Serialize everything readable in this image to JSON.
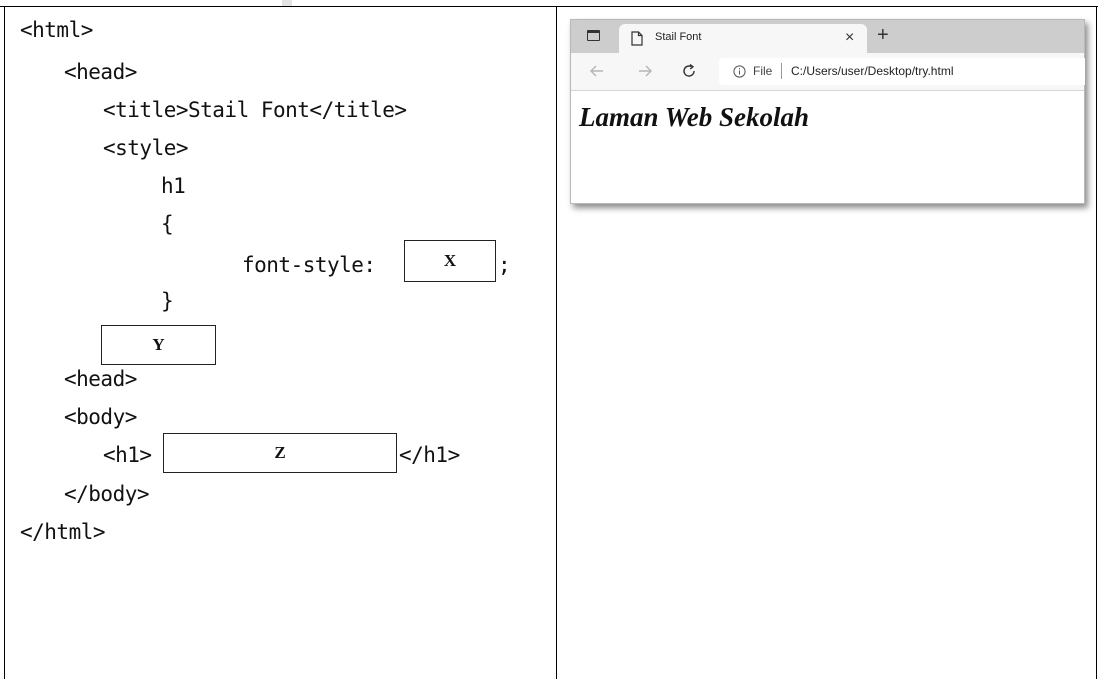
{
  "code": {
    "lines": [
      "<html>",
      "<head>",
      "<title>Stail Font</title>",
      "<style>",
      "h1",
      "{",
      "font-style:",
      "}",
      "<head>",
      "<body>",
      "<h1>",
      "</h1>",
      "</body>",
      "</html>"
    ],
    "semicolon": ";",
    "blanks": {
      "x": "X",
      "y": "Y",
      "z": "Z"
    }
  },
  "browser": {
    "tab_title": "Stail Font",
    "tab_close": "×",
    "new_tab": "+",
    "address": {
      "scheme_label": "File",
      "url": "C:/Users/user/Desktop/try.html"
    },
    "page_heading": "Laman Web Sekolah"
  },
  "icons": [
    "window-icon",
    "page-icon",
    "back-arrow-icon",
    "forward-arrow-icon",
    "reload-icon",
    "info-icon"
  ]
}
